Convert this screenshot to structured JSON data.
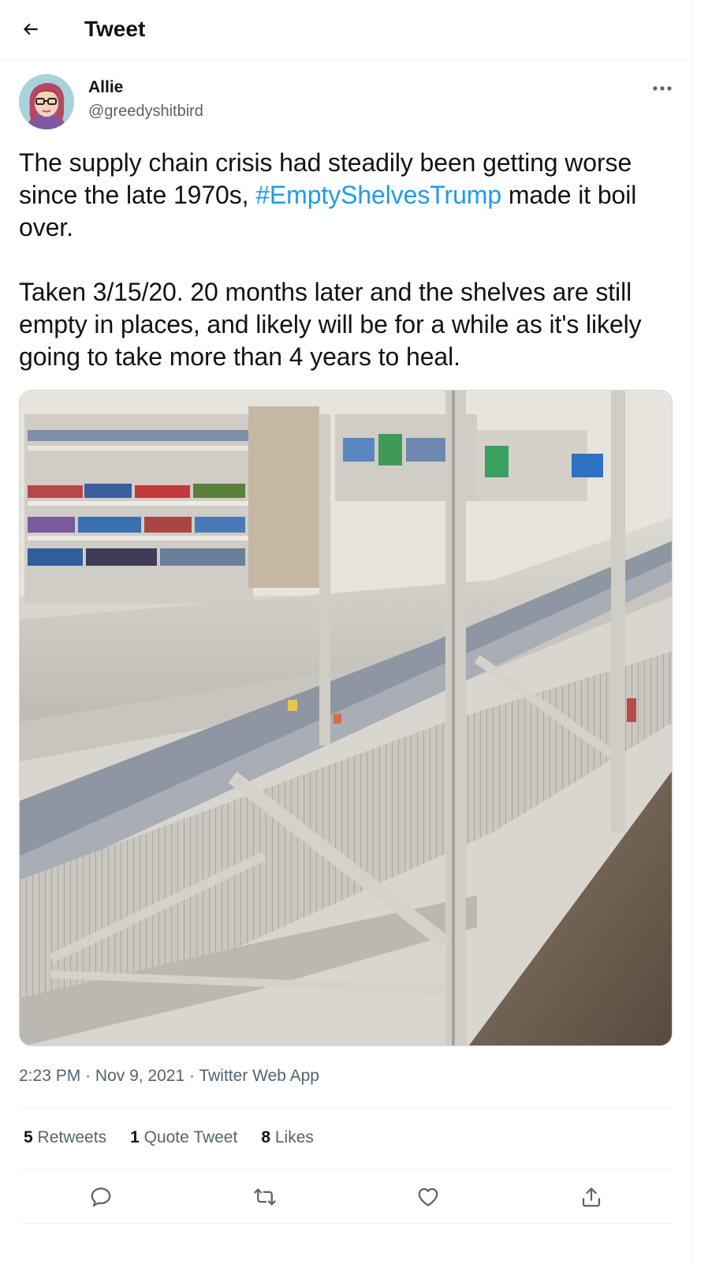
{
  "header": {
    "title": "Tweet",
    "back_icon": "arrow-left-icon"
  },
  "author": {
    "name": "Allie",
    "handle": "@greedyshitbird",
    "avatar_icon": "cartoon-avatar"
  },
  "tweet": {
    "para1_before": "The supply chain crisis had steadily been getting worse since the late 1970s, ",
    "hashtag": "#EmptyShelvesTrump",
    "para1_after": " made it boil over.",
    "para2": "Taken 3/15/20. 20 months later and the shelves are still empty in places, and likely will be for a while as it's likely going to take more than 4 years to heal."
  },
  "meta": {
    "time": "2:23 PM",
    "separator": "·",
    "date": "Nov 9, 2021",
    "source": "Twitter Web App"
  },
  "stats": {
    "retweets_count": "5",
    "retweets_label": "Retweets",
    "quotes_count": "1",
    "quotes_label": "Quote Tweet",
    "likes_count": "8",
    "likes_label": "Likes"
  },
  "actions": {
    "reply_icon": "reply-icon",
    "retweet_icon": "retweet-icon",
    "like_icon": "heart-icon",
    "share_icon": "share-icon"
  },
  "colors": {
    "accent": "#1d9bf0",
    "secondary_text": "#536471",
    "primary_text": "#0f1419",
    "border": "#eff3f4"
  }
}
